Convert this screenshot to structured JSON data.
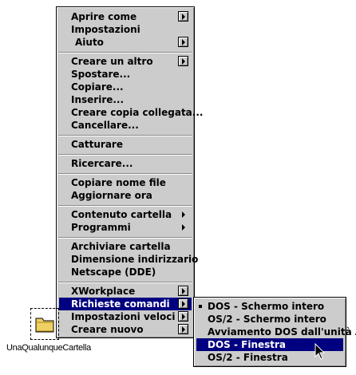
{
  "main_menu": {
    "items": [
      {
        "label": "Aprire come"
      },
      {
        "label": "Impostazioni"
      },
      {
        "label": "Aiuto"
      },
      {
        "label": "Creare un altro"
      },
      {
        "label": "Spostare..."
      },
      {
        "label": "Copiare..."
      },
      {
        "label": "Inserire..."
      },
      {
        "label": "Creare copia collegata..."
      },
      {
        "label": "Cancellare..."
      },
      {
        "label": "Catturare"
      },
      {
        "label": "Ricercare..."
      },
      {
        "label": "Copiare nome file"
      },
      {
        "label": "Aggiornare ora"
      },
      {
        "label": "Contenuto cartella"
      },
      {
        "label": "Programmi"
      },
      {
        "label": "Archiviare cartella"
      },
      {
        "label": "Dimensione indirizzario"
      },
      {
        "label": "Netscape (DDE)"
      },
      {
        "label": "XWorkplace"
      },
      {
        "label": "Richieste comandi"
      },
      {
        "label": "Impostazioni veloci"
      },
      {
        "label": "Creare nuovo"
      }
    ]
  },
  "sub_menu": {
    "items": [
      {
        "label": "DOS - Schermo intero"
      },
      {
        "label": "OS/2 - Schermo intero"
      },
      {
        "label": "Avviamento DOS dall'unità A:"
      },
      {
        "label": "DOS - Finestra"
      },
      {
        "label": "OS/2 - Finestra"
      }
    ]
  },
  "desktop": {
    "icon_label": "UnaQualunqueCartella",
    "icon": "folder-icon"
  },
  "colors": {
    "menu_bg": "#cccccc",
    "highlight": "#000080",
    "folder": "#f0d060"
  }
}
